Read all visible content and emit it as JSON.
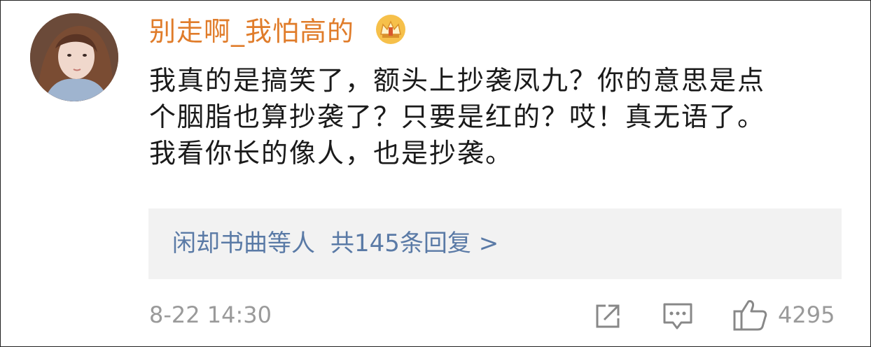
{
  "comment": {
    "username": "别走啊_我怕高的",
    "badge_icon": "crown-badge-icon",
    "lines": [
      "我真的是搞笑了，额头上抄袭凤九？你的意思是点",
      "个胭脂也算抄袭了？只要是红的？哎！真无语了。",
      "我看你长的像人，也是抄袭。"
    ],
    "replies": {
      "names": "闲却书曲等人",
      "count_label": "共145条回复 >"
    },
    "time": "8-22 14:30",
    "likes": "4295"
  },
  "colors": {
    "username": "#e07c2a",
    "link": "#5a7aa6",
    "muted": "#9a9a9a",
    "reply_bg": "#f2f2f2"
  }
}
